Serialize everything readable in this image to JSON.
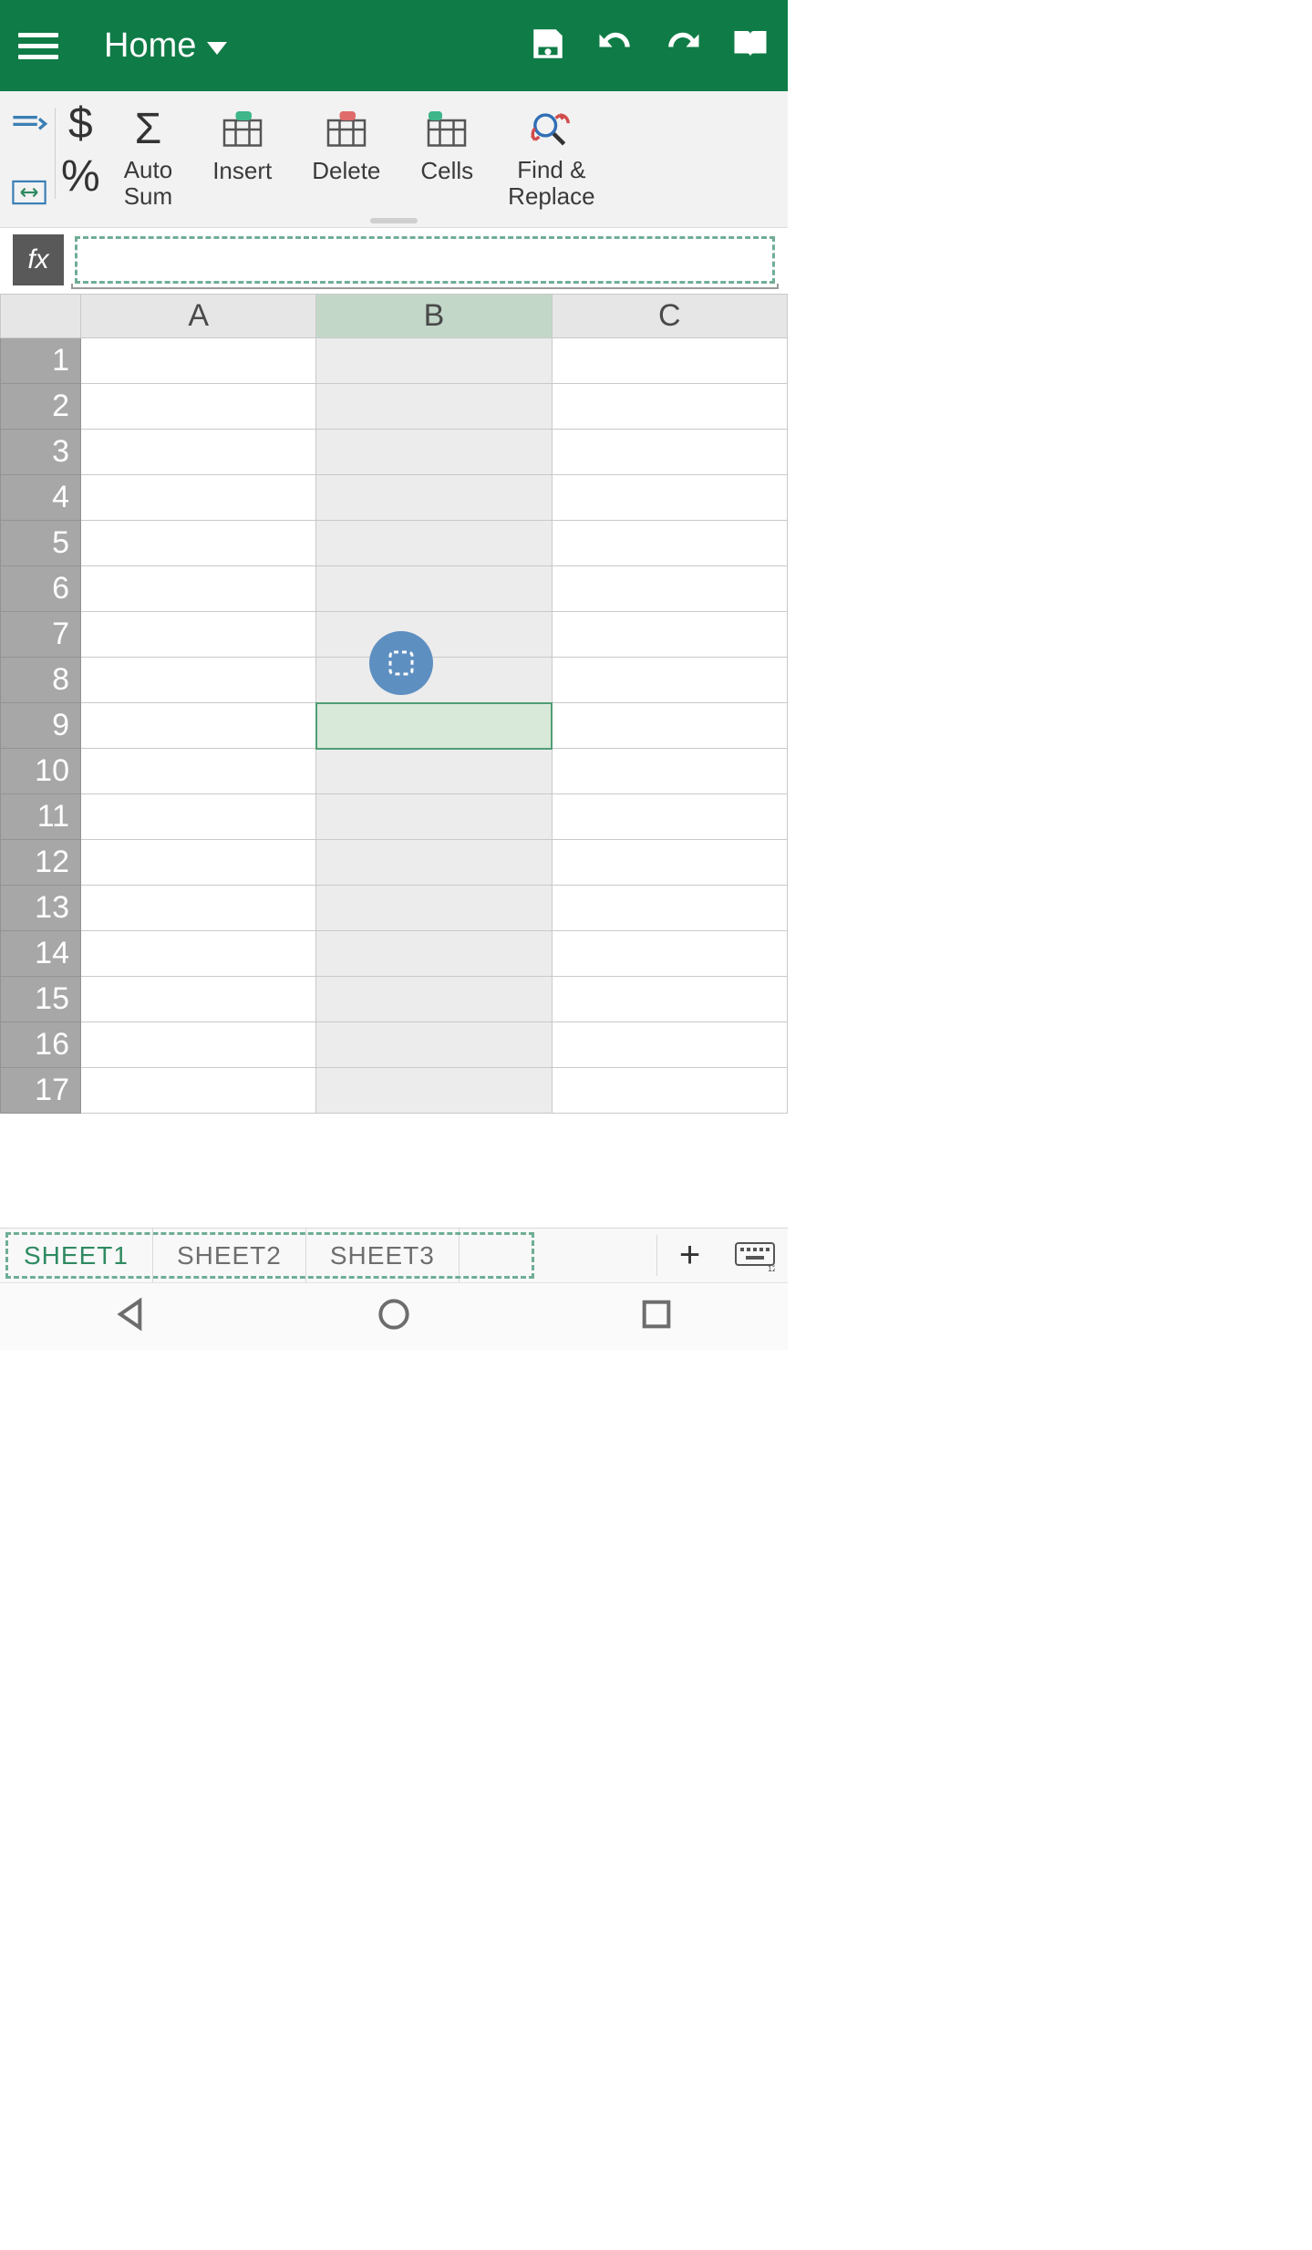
{
  "header": {
    "tab_label": "Home"
  },
  "toolbar": {
    "currency_symbol": "$",
    "percent_symbol": "%",
    "sigma_symbol": "Σ",
    "autosum_label": "Auto Sum",
    "insert_label": "Insert",
    "delete_label": "Delete",
    "cells_label": "Cells",
    "findreplace_label": "Find & Replace"
  },
  "formula": {
    "fx_label": "fx",
    "value": ""
  },
  "grid": {
    "columns": [
      "A",
      "B",
      "C"
    ],
    "rows": [
      "1",
      "2",
      "3",
      "4",
      "5",
      "6",
      "7",
      "8",
      "9",
      "10",
      "11",
      "12",
      "13",
      "14",
      "15",
      "16",
      "17"
    ],
    "selected_column": "B",
    "active_cell": "B9"
  },
  "sheets": {
    "active_index": 0,
    "tabs": [
      "SHEET1",
      "SHEET2",
      "SHEET3"
    ],
    "add_label": "+"
  }
}
